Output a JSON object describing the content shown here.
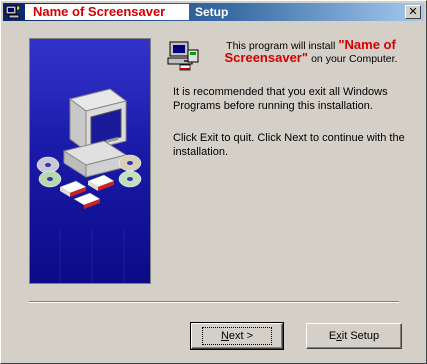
{
  "titlebar": {
    "name": "Name of Screensaver",
    "setup": "Setup",
    "close_glyph": "✕"
  },
  "icons": {
    "app_icon": "installer-icon",
    "small_icon": "computer-install-icon",
    "banner_art": "computer-and-discs-illustration"
  },
  "content": {
    "intro_prefix": "This program will install",
    "intro_name": "\"Name of Screensaver\"",
    "intro_suffix": "on your Computer.",
    "para1": "It is recommended that you exit all Windows Programs before running this installation.",
    "para2": "Click Exit to quit. Click Next to continue with the installation."
  },
  "buttons": {
    "next_label_prefix": "",
    "next_label_mnemonic": "N",
    "next_label_rest": "ext >",
    "exit_label_prefix": "E",
    "exit_label_mnemonic": "x",
    "exit_label_rest": "it Setup"
  },
  "colors": {
    "title_red": "#d40000",
    "banner_blue": "#1a1aa8",
    "dialog_gray": "#d4d0c8"
  }
}
